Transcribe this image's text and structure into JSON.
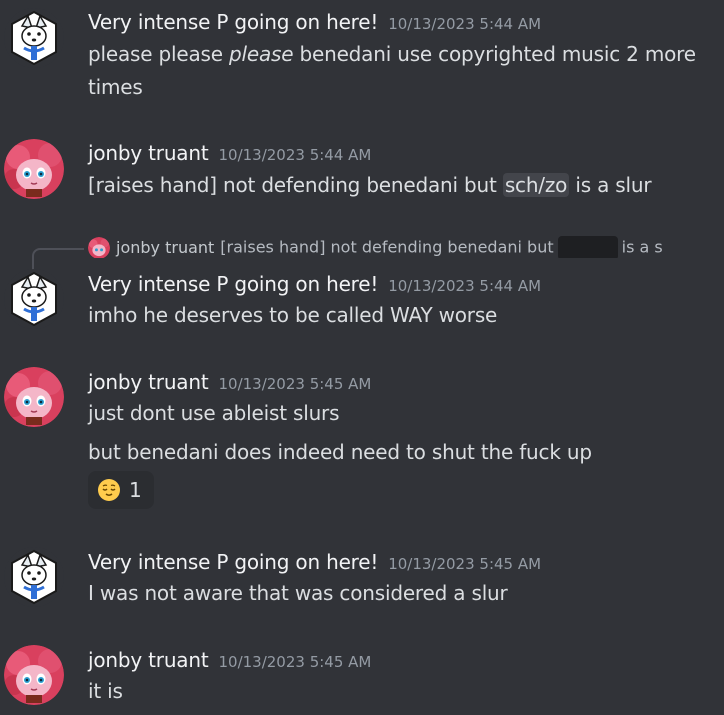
{
  "colors": {
    "background": "#313338",
    "username": "#f2f3f5",
    "timestamp": "#949ba4",
    "text": "#dbdee1"
  },
  "messages": [
    {
      "username": "Very intense P going on here!",
      "timestamp": "10/13/2023 5:44 AM",
      "avatar_icon": "white-wolf-avatar-icon",
      "text_before": "please please ",
      "text_em": "please",
      "text_after": " benedani use copyrighted music 2 more times"
    },
    {
      "username": "jonby truant",
      "timestamp": "10/13/2023 5:44 AM",
      "avatar_icon": "pink-pony-avatar-icon",
      "text_before": "[raises hand] not defending benedani but ",
      "spoiler": "sch/zo",
      "text_after": " is a slur"
    },
    {
      "reply": {
        "username": "jonby truant",
        "text_before": "[raises hand] not defending benedani but",
        "text_after": "is a s"
      },
      "username": "Very intense P going on here!",
      "timestamp": "10/13/2023 5:44 AM",
      "avatar_icon": "white-wolf-avatar-icon",
      "text": "imho he deserves to be called WAY worse"
    },
    {
      "username": "jonby truant",
      "timestamp": "10/13/2023 5:45 AM",
      "avatar_icon": "pink-pony-avatar-icon",
      "text": "just dont use ableist slurs",
      "text2": "but benedani does indeed need to shut the fuck up",
      "reaction": {
        "emoji": "relieved-face-icon",
        "count": "1"
      }
    },
    {
      "username": "Very intense P going on here!",
      "timestamp": "10/13/2023 5:45 AM",
      "avatar_icon": "white-wolf-avatar-icon",
      "text": "I was not aware that was considered a slur"
    },
    {
      "username": "jonby truant",
      "timestamp": "10/13/2023 5:45 AM",
      "avatar_icon": "pink-pony-avatar-icon",
      "text": "it is"
    }
  ]
}
